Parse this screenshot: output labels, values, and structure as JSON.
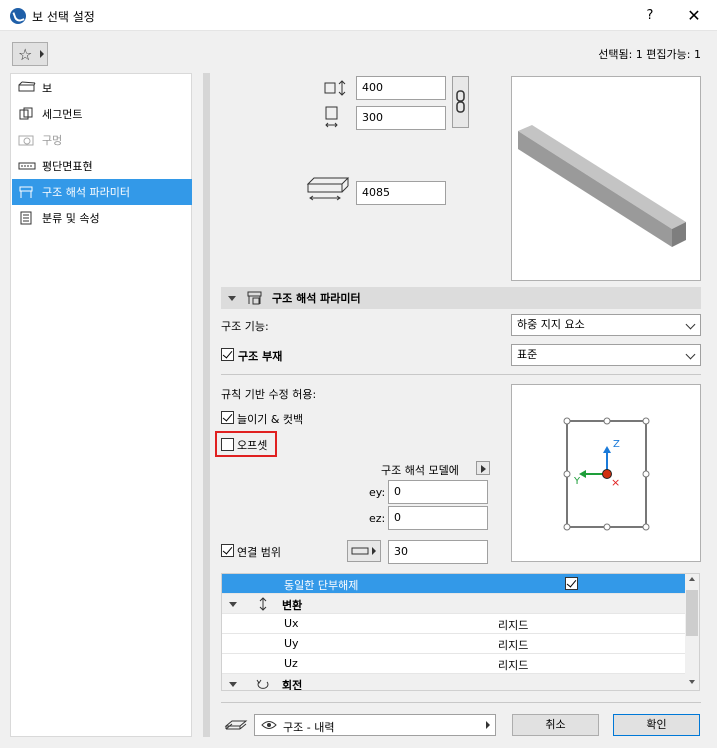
{
  "window": {
    "title": "보 선택 설정",
    "help": "?",
    "close": "✕"
  },
  "selection_info": "선택됨: 1 편집가능: 1",
  "sidebar": {
    "items": [
      {
        "label": "보",
        "icon": "beam-icon",
        "state": "normal"
      },
      {
        "label": "세그먼트",
        "icon": "segment-icon",
        "state": "normal"
      },
      {
        "label": "구멍",
        "icon": "hole-icon",
        "state": "disabled"
      },
      {
        "label": "평단면표현",
        "icon": "floor-plan-icon",
        "state": "normal"
      },
      {
        "label": "구조 해석 파라미터",
        "icon": "structural-icon",
        "state": "active"
      },
      {
        "label": "분류 및 속성",
        "icon": "document-icon",
        "state": "normal"
      }
    ]
  },
  "geometry": {
    "height": "400",
    "width": "300",
    "length": "4085"
  },
  "section": {
    "title": "구조 해석 파라미터"
  },
  "structural_function": {
    "label": "구조 기능:",
    "value": "하중 지지 요소"
  },
  "structural_member": {
    "label": "구조 부재",
    "value": "표준",
    "checked": true
  },
  "rule_based": {
    "label": "규칙 기반 수정 허용:",
    "extend_trim": {
      "label": "늘이기 & 컷백",
      "checked": true
    },
    "offset": {
      "label": "오프셋",
      "checked": false
    }
  },
  "analytical_model": {
    "label": "구조 해석 모델에",
    "ey_label": "ey:",
    "ey": "0",
    "ez_label": "ez:",
    "ez": "0"
  },
  "connection_range": {
    "label": "연결 범위",
    "checked": true,
    "value": "30"
  },
  "axes": {
    "z": "Z",
    "y": "Y",
    "x": "×"
  },
  "table": {
    "rows": [
      {
        "name": "동일한 단부해제",
        "value": "",
        "type": "selected"
      },
      {
        "name": "변환",
        "value": "",
        "type": "group"
      },
      {
        "name": "Ux",
        "value": "리지드",
        "type": "row"
      },
      {
        "name": "Uy",
        "value": "리지드",
        "type": "row"
      },
      {
        "name": "Uz",
        "value": "리지드",
        "type": "row"
      },
      {
        "name": "회전",
        "value": "",
        "type": "group"
      }
    ]
  },
  "footer": {
    "layer": "구조 - 내력",
    "cancel": "취소",
    "ok": "확인"
  },
  "colors": {
    "accent": "#3399e8",
    "highlight_border": "#e02020",
    "axis_z": "#1a7ad9",
    "axis_y": "#1e9e3a",
    "axis_x": "#e02020",
    "origin": "#d03010"
  }
}
